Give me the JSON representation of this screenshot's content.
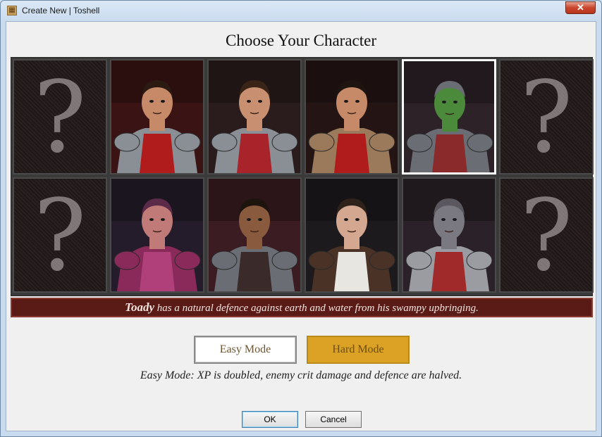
{
  "window": {
    "title": "Create New | Toshell",
    "close_glyph": "✕"
  },
  "heading": "Choose Your Character",
  "characters": [
    {
      "name": "unknown-1",
      "type": "unknown",
      "glyph": "?"
    },
    {
      "name": "warrior-red",
      "type": "portrait",
      "skin": "#c68a68",
      "hair": "#2a1a12",
      "armor": "#8a8f96",
      "accent": "#b01c1c",
      "bg": "#3a1414"
    },
    {
      "name": "warrior-woman",
      "type": "portrait",
      "skin": "#c89070",
      "hair": "#3a2418",
      "armor": "#8a8f96",
      "accent": "#a8242a",
      "bg": "#2a1c1c"
    },
    {
      "name": "warrior-scar",
      "type": "portrait",
      "skin": "#c68a68",
      "hair": "#1e1410",
      "armor": "#9a7a5a",
      "accent": "#b01c1c",
      "bg": "#241414"
    },
    {
      "name": "toady",
      "type": "portrait",
      "skin": "#4a8a3a",
      "hair": "#6a6e74",
      "armor": "#6a6e74",
      "accent": "#8a2a2a",
      "bg": "#2c2228"
    },
    {
      "name": "unknown-2",
      "type": "unknown",
      "glyph": "?"
    },
    {
      "name": "unknown-3",
      "type": "unknown",
      "glyph": "?"
    },
    {
      "name": "dwarf-purple",
      "type": "portrait",
      "skin": "#c07a78",
      "hair": "#5a2a48",
      "armor": "#8a2a5a",
      "accent": "#b0407a",
      "bg": "#241c2a"
    },
    {
      "name": "fighter-bare",
      "type": "portrait",
      "skin": "#8a5a3e",
      "hair": "#1e140e",
      "armor": "#6a6e74",
      "accent": "#3a2a2a",
      "bg": "#3a1c22"
    },
    {
      "name": "scholar-glasses",
      "type": "portrait",
      "skin": "#d4a890",
      "hair": "#2e221a",
      "armor": "#4a3226",
      "accent": "#e8e6e0",
      "bg": "#1c1a1c"
    },
    {
      "name": "cat",
      "type": "portrait",
      "skin": "#7a7880",
      "hair": "#5a585e",
      "armor": "#9a9ca2",
      "accent": "#a02a2a",
      "bg": "#2a2228"
    },
    {
      "name": "unknown-4",
      "type": "unknown",
      "glyph": "?"
    }
  ],
  "selected_index": 4,
  "description": {
    "name": "Toady",
    "text": " has a natural defence against earth and water from his swampy upbringing."
  },
  "modes": {
    "easy_label": "Easy Mode",
    "hard_label": "Hard Mode",
    "selected": "easy",
    "description": "Easy Mode: XP is doubled, enemy crit damage and defence are halved."
  },
  "buttons": {
    "ok": "OK",
    "cancel": "Cancel"
  },
  "colors": {
    "hard_mode": "#dca226",
    "description_bar": "#5a1a16",
    "close_button": "#c9462c"
  }
}
